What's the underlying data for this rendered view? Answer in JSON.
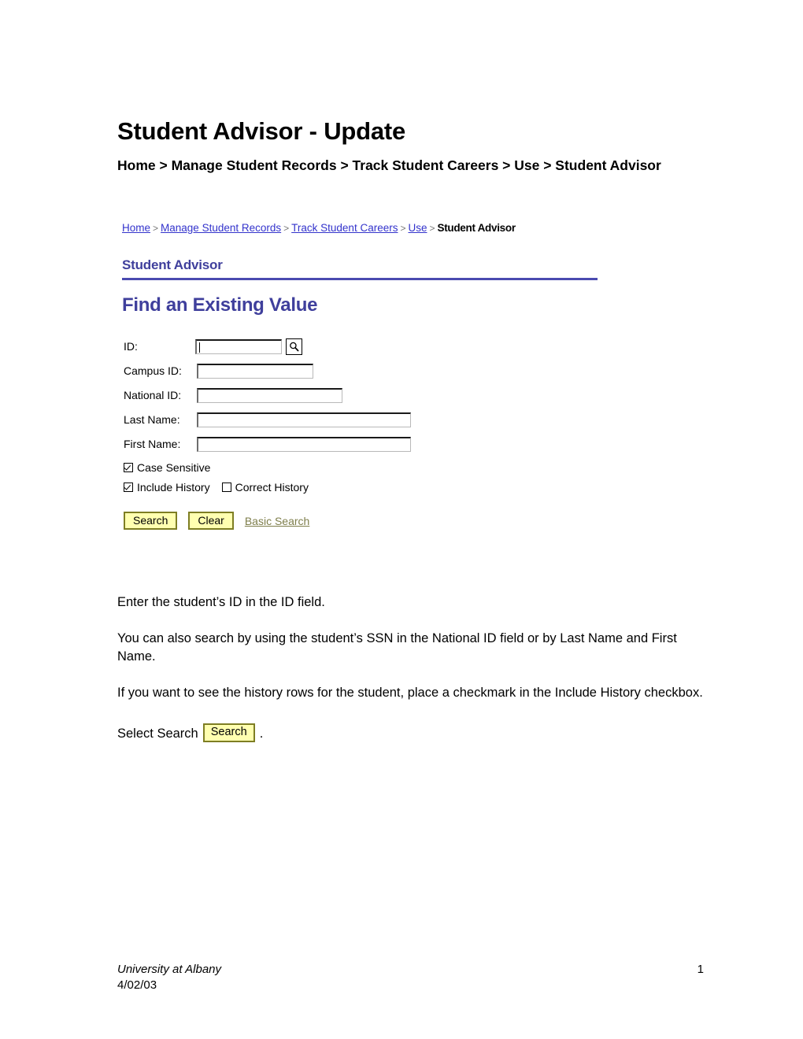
{
  "document": {
    "title": "Student Advisor - Update",
    "navigation_path": "Home > Manage Student Records > Track Student Careers > Use > Student Advisor",
    "paragraphs": {
      "p1": "Enter the student’s ID in the ID field.",
      "p2": "You can also search by using the student’s SSN in the National ID field or by Last Name and First Name.",
      "p3": "If you want to see the history rows for the student, place a checkmark in the Include History checkbox.",
      "p4_prefix": "Select Search",
      "p4_button": "Search",
      "p4_suffix": "."
    }
  },
  "screenshot": {
    "breadcrumb": {
      "links": [
        "Home",
        "Manage Student Records",
        "Track Student Careers",
        "Use"
      ],
      "separator": ">",
      "current": "Student Advisor"
    },
    "page_title": "Student Advisor",
    "heading": "Find an Existing Value",
    "fields": [
      {
        "label": "ID:",
        "value": "",
        "placeholder": "",
        "has_lookup": true
      },
      {
        "label": "Campus ID:",
        "value": "",
        "placeholder": "",
        "has_lookup": false
      },
      {
        "label": "National ID:",
        "value": "",
        "placeholder": "",
        "has_lookup": false
      },
      {
        "label": "Last Name:",
        "value": "",
        "placeholder": "",
        "has_lookup": false
      },
      {
        "label": "First Name:",
        "value": "",
        "placeholder": "",
        "has_lookup": false
      }
    ],
    "checkboxes": [
      {
        "label": "Case Sensitive",
        "checked": true
      },
      {
        "label": "Include History",
        "checked": true
      },
      {
        "label": "Correct History",
        "checked": false
      }
    ],
    "buttons": {
      "search": "Search",
      "clear": "Clear",
      "basic_search": "Basic Search"
    },
    "lookup_icon": "magnifying-glass-icon",
    "colors": {
      "link": "#3333CC",
      "heading": "#3F3F9C",
      "rule": "#4A4AB0",
      "button_face": "#FFFFB0",
      "button_border": "#7E7E23",
      "basic_link": "#7E7E4B"
    }
  },
  "footer": {
    "organization": "University at Albany",
    "date": "4/02/03",
    "page_number": "1"
  }
}
